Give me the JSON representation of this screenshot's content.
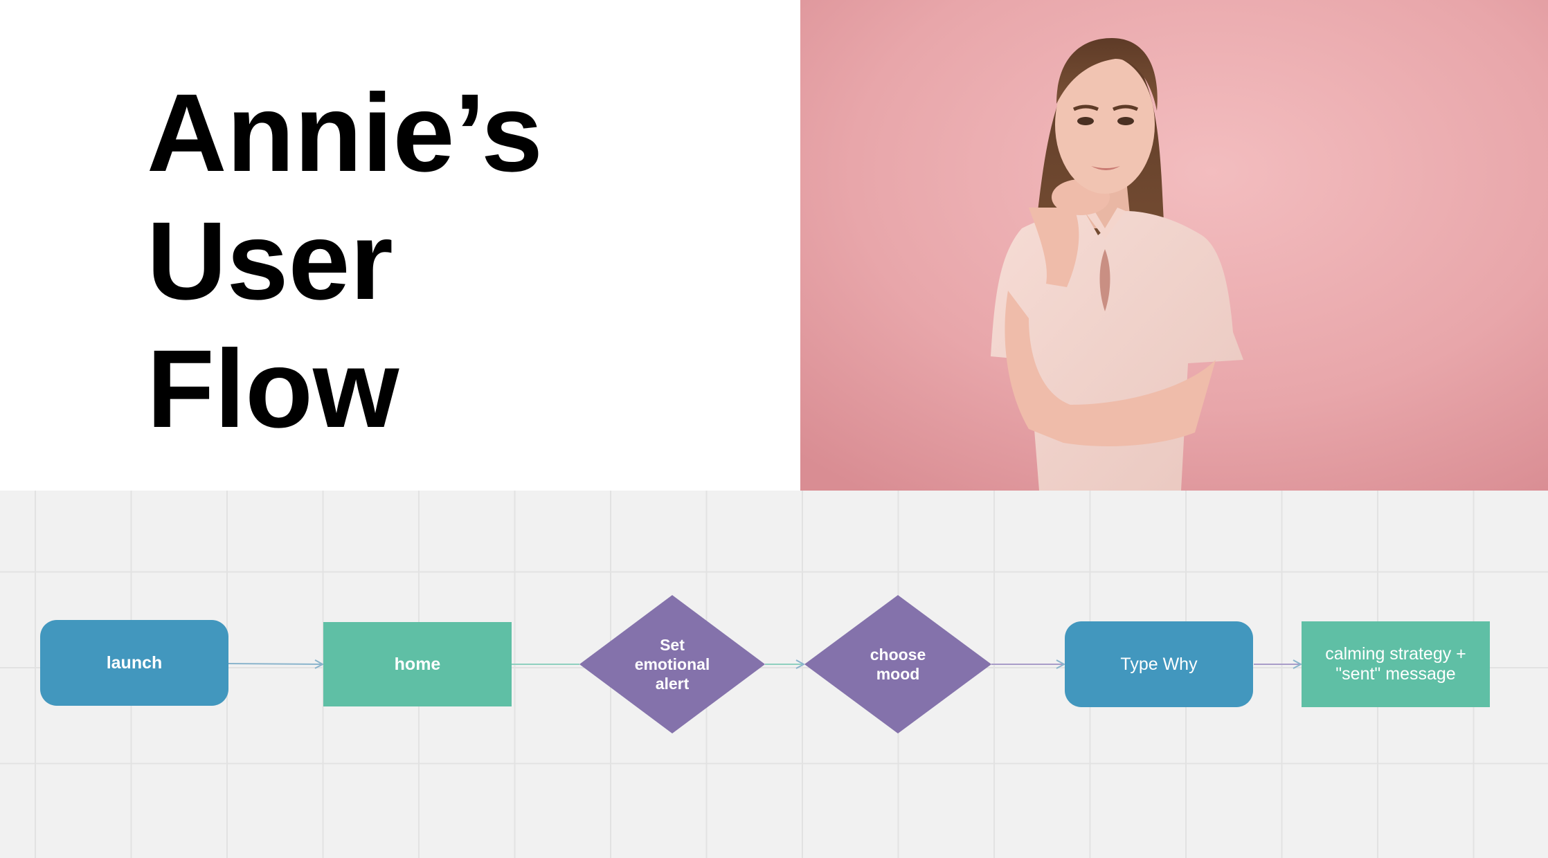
{
  "slide": {
    "title_lines": [
      "Annie’s",
      "User",
      "Flow"
    ],
    "photo": {
      "background_color": "#e6a3a8"
    }
  },
  "flow": {
    "colors": {
      "terminal": "#4297be",
      "process": "#5fbfa5",
      "decision": "#8472ab",
      "connector": "#8ab4cc"
    },
    "nodes": [
      {
        "id": "launch",
        "shape": "rounded-rectangle",
        "label": "launch"
      },
      {
        "id": "home",
        "shape": "rectangle",
        "label": "home"
      },
      {
        "id": "set-alert",
        "shape": "diamond",
        "label_lines": [
          "Set",
          "emotional",
          "alert"
        ]
      },
      {
        "id": "choose-mood",
        "shape": "diamond",
        "label_lines": [
          "choose",
          "mood"
        ]
      },
      {
        "id": "type-why",
        "shape": "rounded-rectangle",
        "label": "Type Why"
      },
      {
        "id": "calming",
        "shape": "rectangle",
        "label_lines": [
          "calming strategy +",
          "\"sent\" message"
        ]
      }
    ],
    "edges": [
      {
        "from": "launch",
        "to": "home",
        "arrow": true
      },
      {
        "from": "home",
        "to": "set-alert",
        "arrow": false
      },
      {
        "from": "set-alert",
        "to": "choose-mood",
        "arrow": true
      },
      {
        "from": "choose-mood",
        "to": "type-why",
        "arrow": true
      },
      {
        "from": "type-why",
        "to": "calming",
        "arrow": true
      }
    ]
  }
}
